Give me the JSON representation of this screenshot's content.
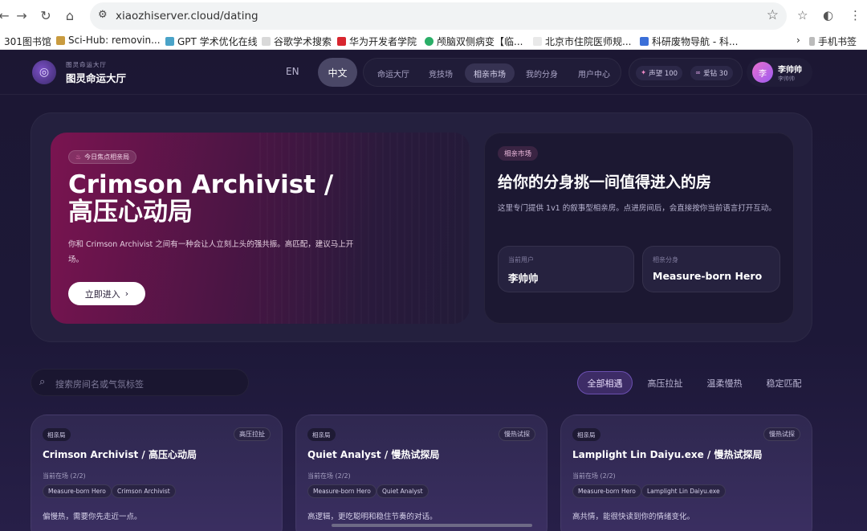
{
  "browser": {
    "url": "xiaozhiserver.cloud/dating",
    "bookmarks": [
      "301图书馆",
      "Sci-Hub: removin...",
      "GPT 学术优化在线",
      "谷歌学术搜索",
      "华为开发者学院",
      "颅脑双侧病变【临...",
      "北京市住院医师规...",
      "科研废物导航 - 科...",
      "手机书签"
    ]
  },
  "header": {
    "brand_sub": "图灵命运大厅",
    "brand_title": "图灵命运大厅",
    "lang_en": "EN",
    "lang_zh": "中文",
    "tabs": [
      "命运大厅",
      "竞技场",
      "相亲市场",
      "我的分身",
      "用户中心"
    ],
    "stats": {
      "reputation": "声望 100",
      "diamonds": "爱钻 30"
    },
    "user": {
      "avatar": "李",
      "name": "李帅帅",
      "sub": "李帅帅"
    }
  },
  "hero": {
    "badge": "今日焦点相亲局",
    "title": "Crimson Archivist / 高压心动局",
    "desc": "你和 Crimson Archivist 之间有一种会让人立刻上头的强共振。高匹配，建议马上开场。",
    "enter": "立即进入"
  },
  "market": {
    "pill": "相亲市场",
    "title": "给你的分身挑一间值得进入的房",
    "desc": "这里专门提供 1v1 的叙事型相亲房。点进房间后，会直接按你当前语言打开互动。",
    "current_user_label": "当前用户",
    "current_user": "李帅帅",
    "avatar_label": "相亲分身",
    "avatar_value": "Measure-born Hero"
  },
  "filters": {
    "search_placeholder": "搜索房间名或气氛标签",
    "chips": [
      "全部相遇",
      "高压拉扯",
      "温柔慢热",
      "稳定匹配"
    ],
    "active": "全部相遇"
  },
  "cards": [
    {
      "tag": "相亲局",
      "mood": "高压拉扯",
      "title": "Crimson Archivist / 高压心动局",
      "onsite": "当前在场 (2/2)",
      "members": [
        "Measure-born Hero",
        "Crimson Archivist"
      ],
      "desc": "偏慢热，需要你先走近一点。"
    },
    {
      "tag": "相亲局",
      "mood": "慢热试探",
      "title": "Quiet Analyst / 慢热试探局",
      "onsite": "当前在场 (2/2)",
      "members": [
        "Measure-born Hero",
        "Quiet Analyst"
      ],
      "desc": "高逻辑，更吃聪明和稳住节奏的对话。"
    },
    {
      "tag": "相亲局",
      "mood": "慢热试探",
      "title": "Lamplight Lin Daiyu.exe / 慢热试探局",
      "onsite": "当前在场 (2/2)",
      "members": [
        "Measure-born Hero",
        "Lamplight Lin Daiyu.exe"
      ],
      "desc": "高共情，能很快读到你的情绪变化。"
    }
  ]
}
